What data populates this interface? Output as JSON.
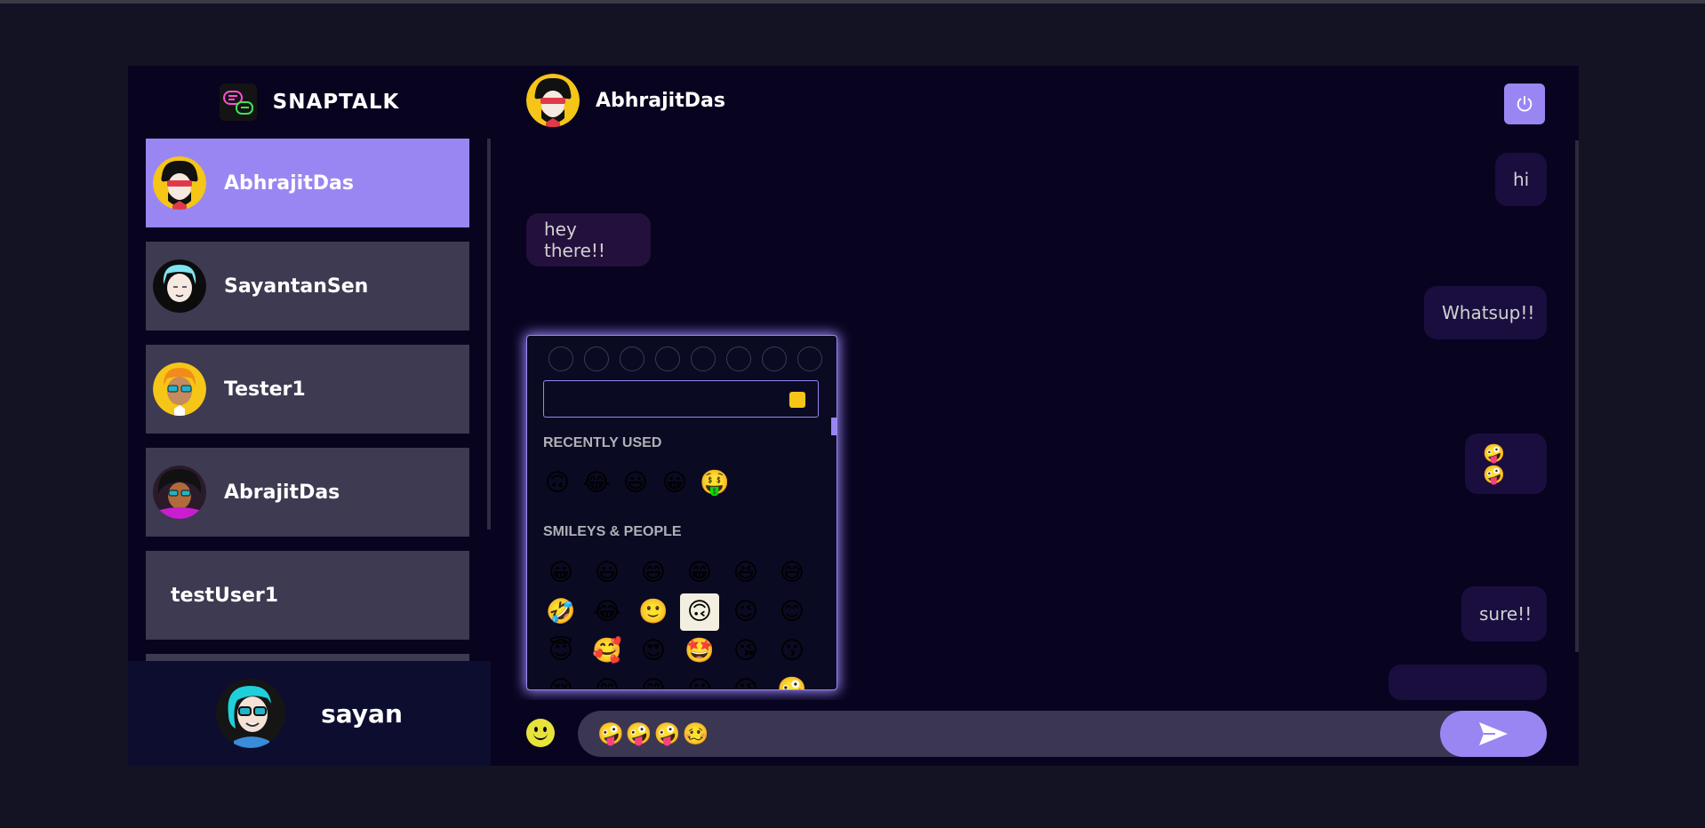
{
  "brand": {
    "name": "SNAPTALK",
    "logo_icon": "chat-bubbles-icon"
  },
  "contacts": [
    {
      "name": "AbhrajitDas",
      "avatar": "avatar-bearded-sunglasses",
      "selected": true
    },
    {
      "name": "SayantanSen",
      "avatar": "avatar-blue-hair"
    },
    {
      "name": "Tester1",
      "avatar": "avatar-glasses-orange"
    },
    {
      "name": "AbrajitDas",
      "avatar": "avatar-curly-hair"
    },
    {
      "name": "testUser1",
      "avatar": ""
    }
  ],
  "current_user": {
    "name": "sayan",
    "avatar": "avatar-cyan-hair-sunglasses"
  },
  "chat_header": {
    "name": "AbhrajitDas",
    "avatar": "avatar-bearded-sunglasses",
    "logout_icon": "power-icon"
  },
  "messages": [
    {
      "text": "hi",
      "type": "sent"
    },
    {
      "text": "hey there!!",
      "type": "received"
    },
    {
      "text": "Whatsup!!",
      "type": "sent"
    },
    {
      "text": "🤪🤪",
      "type": "sent"
    },
    {
      "text": "sure!!",
      "type": "sent"
    }
  ],
  "emoji_picker": {
    "categories": [
      "people-icon",
      "food-icon",
      "nature-icon",
      "places-icon",
      "activity-icon",
      "clock-icon",
      "heart-icon",
      "globe-icon"
    ],
    "search_placeholder": "",
    "recent_label": "RECENTLY USED",
    "recent": [
      "🙃",
      "😂",
      "😃",
      "😀",
      "🤑"
    ],
    "smileys_label": "SMILEYS & PEOPLE",
    "smileys": [
      "😀",
      "😃",
      "😄",
      "😁",
      "😆",
      "😅",
      "🤣",
      "😂",
      "🙂",
      "🙃",
      "😉",
      "😊",
      "😇",
      "🥰",
      "😍",
      "🤩",
      "😘",
      "😗",
      "😚",
      "😙",
      "😋",
      "😛",
      "😜",
      "🤪"
    ],
    "highlighted_index": 9
  },
  "input": {
    "value": "🤪🤪🤪🥴",
    "placeholder": ""
  },
  "colors": {
    "accent": "#9a86f3",
    "background": "#131324",
    "panel": "#080420",
    "card": "#3d3a51"
  }
}
